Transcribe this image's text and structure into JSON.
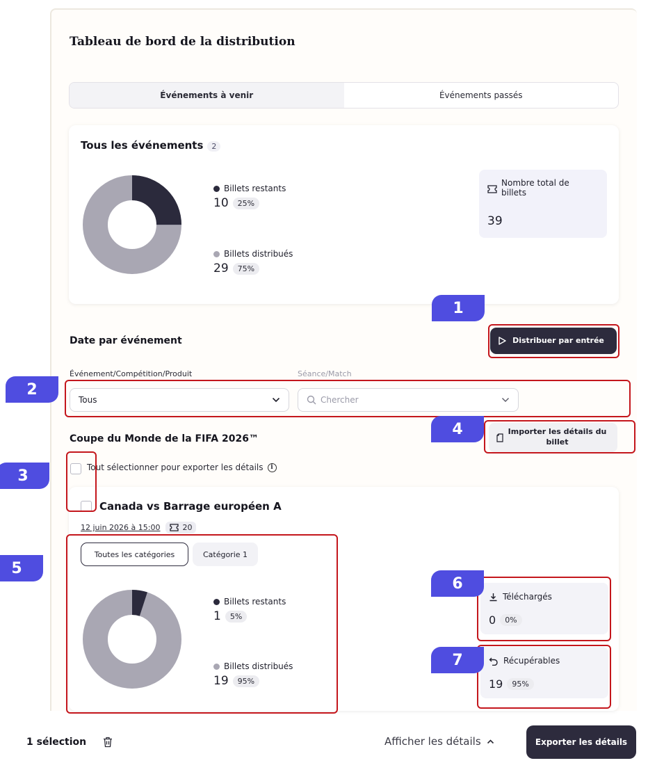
{
  "title": "Tableau de bord de la distribution",
  "tabs": [
    {
      "label": "Événements à venir",
      "active": true
    },
    {
      "label": "Événements passés",
      "active": false
    }
  ],
  "summary": {
    "title": "Tous les événements",
    "count": "2",
    "remaining": {
      "label": "Billets restants",
      "value": "10",
      "percent": "25%",
      "fraction": 0.25
    },
    "distributed": {
      "label": "Billets distribués",
      "value": "29",
      "percent": "75%",
      "fraction": 0.75
    },
    "total": {
      "label": "Nombre total de billets",
      "value": "39"
    }
  },
  "date_section": {
    "title": "Date par événement",
    "distribute_button": "Distribuer par entrée"
  },
  "filters": {
    "event_label": "Événement/Compétition/Produit",
    "event_value": "Tous",
    "session_label": "Séance/Match",
    "session_placeholder": "Chercher"
  },
  "competition": {
    "title": "Coupe du Monde de la FIFA 2026™",
    "import_button": "Importer les détails du billet",
    "select_all_label": "Tout sélectionner pour exporter les détails"
  },
  "event": {
    "title": "Canada vs Barrage européen A",
    "date": "12 juin 2026 à 15:00",
    "tickets": "20",
    "chips": [
      {
        "label": "Toutes les catégories",
        "active": true
      },
      {
        "label": "Catégorie 1",
        "active": false
      }
    ],
    "remaining": {
      "label": "Billets restants",
      "value": "1",
      "percent": "5%",
      "fraction": 0.05
    },
    "distributed": {
      "label": "Billets distribués",
      "value": "19",
      "percent": "95%",
      "fraction": 0.95
    },
    "downloaded": {
      "label": "Téléchargés",
      "value": "0",
      "percent": "0%"
    },
    "recoverable": {
      "label": "Récupérables",
      "value": "19",
      "percent": "95%"
    }
  },
  "bottom_bar": {
    "selection": "1 sélection",
    "details_link": "Afficher les détails",
    "export_button": "Exporter les détails"
  },
  "markers": [
    "1",
    "2",
    "3",
    "4",
    "5",
    "6",
    "7"
  ],
  "colors": {
    "remaining": "#2b2a3c",
    "distributed": "#a9a7b3",
    "accent": "#4f4de0",
    "highlight": "#c4161c"
  },
  "icons": [
    "ticket-icon",
    "play-icon",
    "search-icon",
    "chevron-down-icon",
    "document-icon",
    "info-icon",
    "download-icon",
    "undo-icon",
    "trash-icon",
    "chevron-up-icon"
  ]
}
